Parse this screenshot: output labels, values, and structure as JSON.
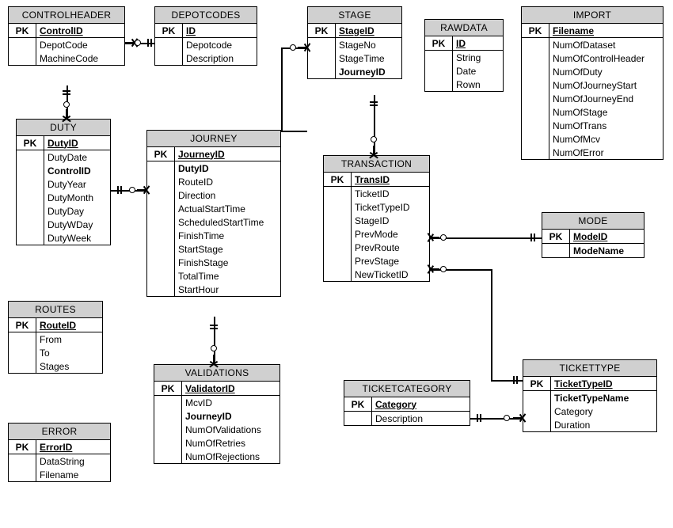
{
  "diagram_type": "entity-relationship",
  "entities": {
    "controlheader": {
      "title": "CONTROLHEADER",
      "pk_label": "PK",
      "pk": [
        "ControlID"
      ],
      "attrs": [
        "DepotCode",
        "MachineCode"
      ]
    },
    "depotcodes": {
      "title": "DEPOTCODES",
      "pk_label": "PK",
      "pk": [
        "ID"
      ],
      "attrs": [
        "Depotcode",
        "Description"
      ]
    },
    "stage": {
      "title": "STAGE",
      "pk_label": "PK",
      "pk": [
        "StageID"
      ],
      "attrs": [
        "StageNo",
        "StageTime"
      ],
      "fk": [
        "JourneyID"
      ]
    },
    "rawdata": {
      "title": "RAWDATA",
      "pk_label": "PK",
      "pk": [
        "ID"
      ],
      "attrs": [
        "String",
        "Date",
        "Rown"
      ]
    },
    "import": {
      "title": "IMPORT",
      "pk_label": "PK",
      "pk": [
        "Filename"
      ],
      "attrs": [
        "NumOfDataset",
        "NumOfControlHeader",
        "NumOfDuty",
        "NumOfJourneyStart",
        "NumOfJourneyEnd",
        "NumOfStage",
        "NumOfTrans",
        "NumOfMcv",
        "NumOfError"
      ]
    },
    "duty": {
      "title": "DUTY",
      "pk_label": "PK",
      "pk": [
        "DutyID"
      ],
      "attrs": [
        "DutyDate"
      ],
      "fk": [
        "ControlID"
      ],
      "attrs2": [
        "DutyYear",
        "DutyMonth",
        "DutyDay",
        "DutyWDay",
        "DutyWeek"
      ]
    },
    "journey": {
      "title": "JOURNEY",
      "pk_label": "PK",
      "pk": [
        "JourneyID"
      ],
      "fk": [
        "DutyID"
      ],
      "attrs": [
        "RouteID",
        "Direction",
        "ActualStartTime",
        "ScheduledStartTime",
        "FinishTime",
        "StartStage",
        "FinishStage",
        "TotalTime",
        "StartHour"
      ]
    },
    "transaction": {
      "title": "TRANSACTION",
      "pk_label": "PK",
      "pk": [
        "TransID"
      ],
      "attrs": [
        "TicketID",
        "TicketTypeID",
        "StageID",
        "PrevMode",
        "PrevRoute",
        "PrevStage",
        "NewTicketID"
      ]
    },
    "mode": {
      "title": "MODE",
      "pk_label": "PK",
      "pk": [
        "ModeID"
      ],
      "attrs": [
        "ModeName"
      ]
    },
    "routes": {
      "title": "ROUTES",
      "pk_label": "PK",
      "pk": [
        "RouteID"
      ],
      "attrs": [
        "From",
        "To",
        "Stages"
      ]
    },
    "validations": {
      "title": "VALIDATIONS",
      "pk_label": "PK",
      "pk": [
        "ValidatorID"
      ],
      "attrs": [
        "McvID"
      ],
      "fk": [
        "JourneyID"
      ],
      "attrs2": [
        "NumOfValidations",
        "NumOfRetries",
        "NumOfRejections"
      ]
    },
    "ticketcategory": {
      "title": "TICKETCATEGORY",
      "pk_label": "PK",
      "pk": [
        "Category"
      ],
      "attrs": [
        "Description"
      ]
    },
    "tickettype": {
      "title": "TICKETTYPE",
      "pk_label": "PK",
      "pk": [
        "TicketTypeID"
      ],
      "fk": [
        "TicketTypeName"
      ],
      "attrs": [
        "Category",
        "Duration"
      ]
    },
    "error": {
      "title": "ERROR",
      "pk_label": "PK",
      "pk": [
        "ErrorID"
      ],
      "attrs": [
        "DataString",
        "Filename"
      ]
    }
  },
  "relationships": [
    {
      "from": "CONTROLHEADER",
      "to": "DEPOTCODES",
      "type": "many-to-one"
    },
    {
      "from": "DUTY",
      "to": "CONTROLHEADER",
      "type": "many-to-one"
    },
    {
      "from": "JOURNEY",
      "to": "DUTY",
      "type": "many-to-one"
    },
    {
      "from": "STAGE",
      "to": "JOURNEY",
      "type": "many-to-one"
    },
    {
      "from": "TRANSACTION",
      "to": "STAGE",
      "type": "many-to-one"
    },
    {
      "from": "VALIDATIONS",
      "to": "JOURNEY",
      "type": "many-to-one"
    },
    {
      "from": "TRANSACTION",
      "to": "MODE",
      "type": "many-to-one"
    },
    {
      "from": "TRANSACTION",
      "to": "TICKETTYPE",
      "type": "many-to-one"
    },
    {
      "from": "TICKETTYPE",
      "to": "TICKETCATEGORY",
      "type": "many-to-one"
    }
  ]
}
